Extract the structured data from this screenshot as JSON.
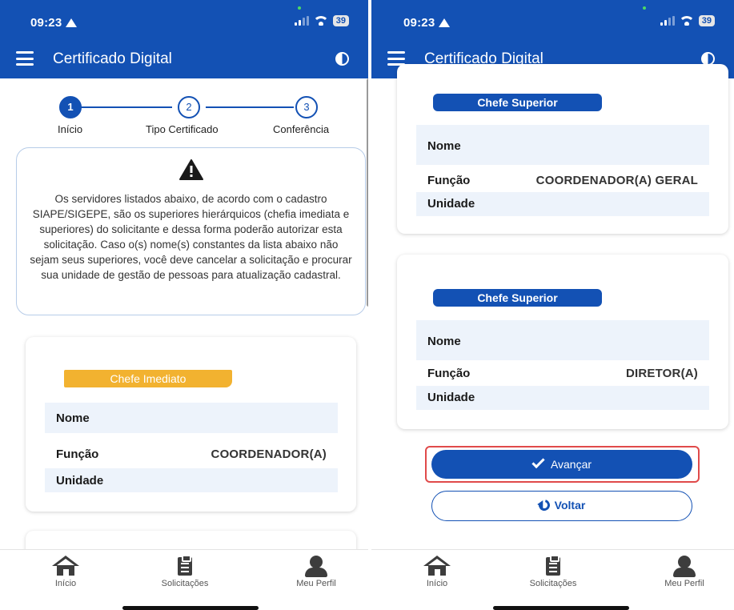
{
  "screens": [
    {
      "status_time": "09:23",
      "battery": "39",
      "app_title": "Certificado Digital",
      "steps": [
        {
          "number": "1",
          "label": "Início"
        },
        {
          "number": "2",
          "label": "Tipo Certificado"
        },
        {
          "number": "3",
          "label": "Conferência"
        }
      ],
      "notice_text": "Os servidores listados abaixo, de acordo com o cadastro SIAPE/SIGEPE, são os superiores hierárquicos (chefia imediata e superiores) do solicitante e dessa forma poderão autorizar esta solicitação. Caso o(s) nome(s) constantes da lista abaixo não sejam seus superiores, você deve cancelar a solicitação e procurar sua unidade de gestão de pessoas para atualização cadastral.",
      "card": {
        "badge": "Chefe Imediato",
        "rows": [
          {
            "label": "Nome",
            "value": ""
          },
          {
            "label": "Função",
            "value": "COORDENADOR(A)"
          },
          {
            "label": "Unidade",
            "value": ""
          }
        ]
      }
    },
    {
      "status_time": "09:23",
      "battery": "39",
      "app_title": "Certificado Digital",
      "cards": [
        {
          "badge": "Chefe Superior",
          "rows": [
            {
              "label": "Nome",
              "value": ""
            },
            {
              "label": "Função",
              "value": "COORDENADOR(A) GERAL"
            },
            {
              "label": "Unidade",
              "value": ""
            }
          ]
        },
        {
          "badge": "Chefe Superior",
          "rows": [
            {
              "label": "Nome",
              "value": ""
            },
            {
              "label": "Função",
              "value": "DIRETOR(A)"
            },
            {
              "label": "Unidade",
              "value": ""
            }
          ]
        }
      ],
      "advance_label": "Avançar",
      "back_label": "Voltar"
    }
  ],
  "nav": {
    "items": [
      {
        "label": "Início",
        "icon": "home-icon"
      },
      {
        "label": "Solicitações",
        "icon": "clipboard-icon"
      },
      {
        "label": "Meu Perfil",
        "icon": "user-icon"
      }
    ]
  },
  "colors": {
    "primary": "#1351b4",
    "badge_yellow": "#f2b230",
    "row_shade": "#edf3fb",
    "highlight": "#e04a4a"
  }
}
